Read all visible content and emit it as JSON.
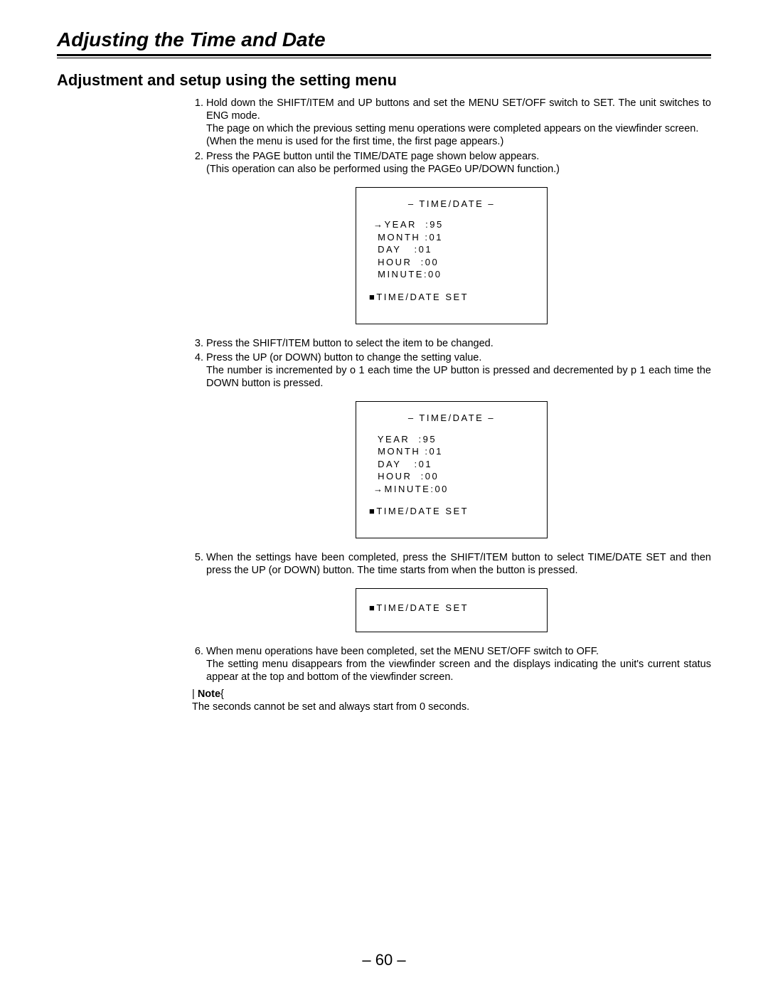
{
  "title": "Adjusting the Time and Date",
  "section": "Adjustment and setup using the setting menu",
  "steps": {
    "s1": {
      "text": "Hold down the SHIFT/ITEM and UP buttons and set the MENU SET/OFF switch to SET. The unit switches to ENG mode.",
      "sub1": "The page on which the previous setting menu operations were completed appears on the viewfinder screen.",
      "sub2": "(When the menu is used for the first time, the first page appears.)"
    },
    "s2": {
      "text": "Press the PAGE button until the TIME/DATE page shown below appears.",
      "sub1": "(This operation can also be performed using the PAGEo UP/DOWN function.)"
    },
    "s3": {
      "text": "Press the SHIFT/ITEM button to select the item to be changed."
    },
    "s4": {
      "text": "Press the UP (or DOWN) button to change the setting value.",
      "sub1": "The number is incremented by o 1 each time the UP button is pressed and decremented by p 1 each time the DOWN button is pressed."
    },
    "s5": {
      "text": "When the settings have been completed, press the SHIFT/ITEM button to select TIME/DATE SET and then press the UP (or DOWN) button. The time starts from when the button is pressed."
    },
    "s6": {
      "text": "When menu operations have been completed, set the MENU SET/OFF switch to OFF.",
      "sub1": "The setting menu disappears from the viewfinder screen and the displays indicating the unit's current status appear at the top and bottom of the viewfinder screen."
    }
  },
  "screen1": {
    "title": "– TIME/DATE –",
    "year": "→YEAR  :95",
    "month": " MONTH :01",
    "day": " DAY   :01",
    "hour": " HOUR  :00",
    "minute": " MINUTE:00",
    "set": "■TIME/DATE SET"
  },
  "screen2": {
    "title": "– TIME/DATE –",
    "year": " YEAR  :95",
    "month": " MONTH :01",
    "day": " DAY   :01",
    "hour": " HOUR  :00",
    "minute": "→MINUTE:00",
    "set": "■TIME/DATE SET"
  },
  "screen3": {
    "set": "■TIME/DATE SET"
  },
  "note": {
    "open": "|",
    "label": "Note",
    "close": "{",
    "text": "The seconds cannot be set and always start from 0 seconds."
  },
  "pagenum": "– 60 –"
}
